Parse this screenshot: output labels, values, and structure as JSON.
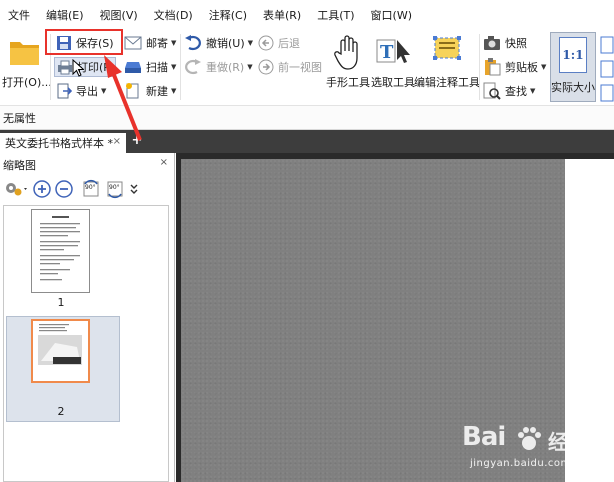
{
  "menu": [
    "文件",
    "编辑(E)",
    "视图(V)",
    "文档(D)",
    "注释(C)",
    "表单(R)",
    "工具(T)",
    "窗口(W)"
  ],
  "ribbon": {
    "open": "打开(O)...",
    "save": "保存(S)",
    "print": "打印(P)",
    "export": "导出",
    "mail": "邮寄",
    "scan": "扫描",
    "create": "新建",
    "undo": "撤销(U)",
    "redo": "重做(R)",
    "back": "后退",
    "forward": "前一视图",
    "hand": "手形工具",
    "select": "选取工具",
    "edit_annot": "编辑注释工具",
    "snapshot": "快照",
    "clipboard": "剪贴板",
    "find": "查找",
    "actual_size": "实际大小",
    "actual_size_icon_text": "1:1"
  },
  "properties_label": "无属性",
  "tab": {
    "title": "英文委托书格式样本 *",
    "close": "×",
    "add": "+"
  },
  "thumbnail_panel": {
    "title": "缩略图",
    "close": "×",
    "rotate_left": "90°",
    "rotate_right": "90°",
    "pages": [
      {
        "label": "1"
      },
      {
        "label": "2"
      }
    ]
  },
  "watermark": {
    "brand": "Bai",
    "brand2": "经验",
    "url": "jingyan.baidu.com"
  },
  "colors": {
    "highlight": "#e8322b",
    "selected_page_border": "#f08a4b",
    "tab_bar": "#3d3d3d"
  }
}
